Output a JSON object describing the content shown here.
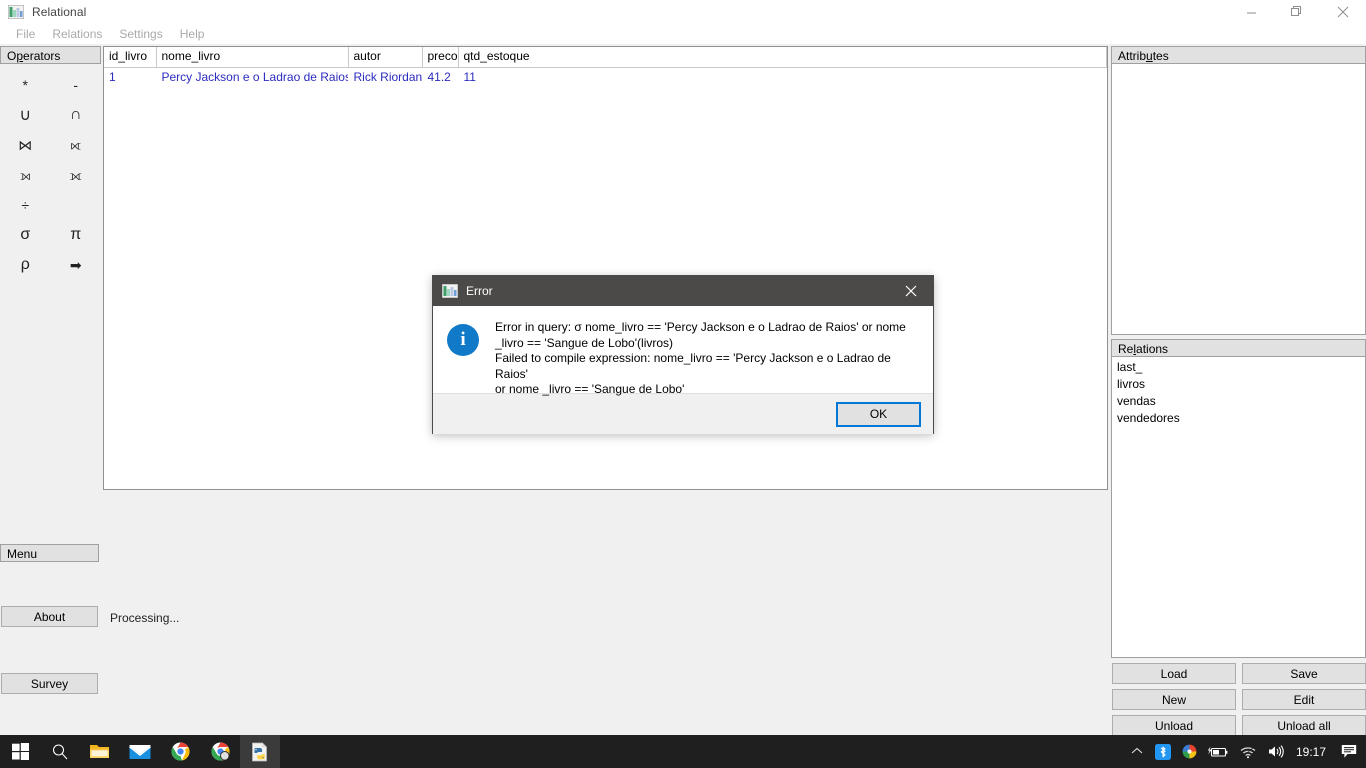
{
  "window": {
    "title": "Relational",
    "app_icon": "chart-bars-icon",
    "minimize_label": "Minimize",
    "restore_label": "Restore",
    "close_label": "Close"
  },
  "menubar": {
    "items": [
      {
        "label": "File",
        "name": "menu-file"
      },
      {
        "label": "Relations",
        "name": "menu-relations"
      },
      {
        "label": "Settings",
        "name": "menu-settings"
      },
      {
        "label": "Help",
        "name": "menu-help"
      }
    ]
  },
  "operators": {
    "header": "Operators",
    "items": [
      {
        "symbol": "*",
        "name": "operator-cartesian-product"
      },
      {
        "symbol": "-",
        "name": "operator-difference"
      },
      {
        "symbol": "∪",
        "name": "operator-union"
      },
      {
        "symbol": "∩",
        "name": "operator-intersection"
      },
      {
        "symbol": "⋈",
        "name": "operator-natural-join"
      },
      {
        "symbol": "⟖",
        "name": "operator-right-outer-join"
      },
      {
        "symbol": "⟕",
        "name": "operator-left-outer-join"
      },
      {
        "symbol": "⟗",
        "name": "operator-full-outer-join"
      },
      {
        "symbol": "÷",
        "name": "operator-division"
      },
      {
        "symbol": "",
        "name": "operator-blank"
      },
      {
        "symbol": "σ",
        "name": "operator-selection"
      },
      {
        "symbol": "π",
        "name": "operator-projection"
      },
      {
        "symbol": "ρ",
        "name": "operator-rename"
      },
      {
        "symbol": "➡",
        "name": "operator-arrow"
      }
    ]
  },
  "left_menu": {
    "header": "Menu",
    "about_label": "About",
    "survey_label": "Survey",
    "status": "Processing..."
  },
  "result_table": {
    "columns": [
      "id_livro",
      "nome_livro",
      "autor",
      "preco",
      "qtd_estoque"
    ],
    "rows": [
      [
        "1",
        "Percy Jackson e o Ladrao de Raios",
        "Rick Riordan",
        "41.2",
        "11"
      ]
    ]
  },
  "attributes": {
    "header": "Attributes",
    "items": []
  },
  "relations": {
    "header": "Relations",
    "items": [
      "last_",
      "livros",
      "vendas",
      "vendedores"
    ]
  },
  "relation_buttons": [
    {
      "label": "Load",
      "name": "load-button"
    },
    {
      "label": "Save",
      "name": "save-button"
    },
    {
      "label": "New",
      "name": "new-button"
    },
    {
      "label": "Edit",
      "name": "edit-button"
    },
    {
      "label": "Unload",
      "name": "unload-button"
    },
    {
      "label": "Unload all",
      "name": "unload-all-button"
    }
  ],
  "dialog": {
    "title": "Error",
    "icon": "info-icon",
    "icon_glyph": "i",
    "message": "Error in query: σ nome_livro == 'Percy Jackson e o Ladrao de Raios' or nome\n_livro == 'Sangue de Lobo'(livros)\nFailed to compile expression: nome_livro == 'Percy Jackson e o Ladrao de Raios'\nor nome _livro == 'Sangue de Lobo'",
    "ok_label": "OK",
    "close_label": "✕",
    "accent_color": "#0078d7",
    "info_color": "#1079c8"
  },
  "taskbar": {
    "items": [
      {
        "name": "start-button",
        "icon": "windows-logo-icon"
      },
      {
        "name": "search-button",
        "icon": "search-icon"
      },
      {
        "name": "file-explorer-button",
        "icon": "folder-icon"
      },
      {
        "name": "mail-button",
        "icon": "envelope-icon"
      },
      {
        "name": "chrome-button",
        "icon": "chrome-icon"
      },
      {
        "name": "chrome-second-button",
        "icon": "chrome-icon"
      },
      {
        "name": "relational-app-button",
        "icon": "python-icon"
      }
    ],
    "tray": [
      {
        "name": "show-hidden-icons",
        "icon": "chevron-up-icon"
      },
      {
        "name": "bluetooth-icon",
        "icon": "bluetooth-icon"
      },
      {
        "name": "color-app-icon",
        "icon": "color-wheel-icon"
      },
      {
        "name": "battery-icon",
        "icon": "battery-charging-icon"
      },
      {
        "name": "network-icon",
        "icon": "wifi-icon"
      },
      {
        "name": "volume-icon",
        "icon": "speaker-icon"
      }
    ],
    "clock": "19:17",
    "action_center": "notification-icon"
  }
}
